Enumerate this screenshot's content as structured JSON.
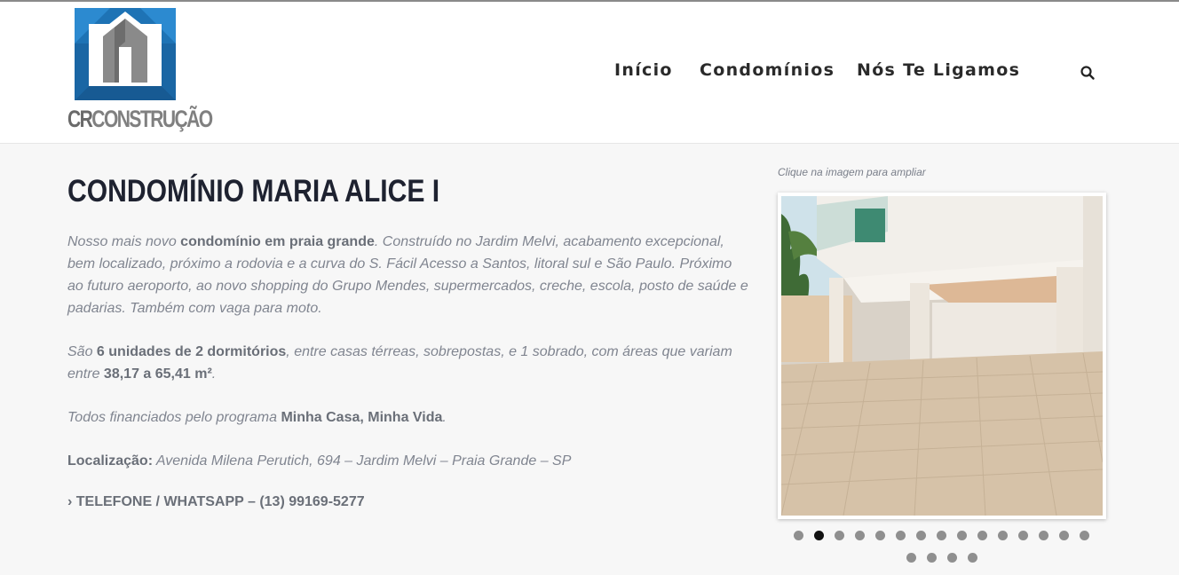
{
  "header": {
    "logo": {
      "brand_cr": "CR",
      "brand_rest": "CONSTRUÇÃO"
    },
    "nav": [
      {
        "label": "Início"
      },
      {
        "label": "Condomínios"
      },
      {
        "label": "Nós Te Ligamos"
      }
    ],
    "search_icon": "search-icon"
  },
  "page": {
    "title": "CONDOMÍNIO MARIA ALICE I",
    "p1": {
      "a": "Nosso mais novo ",
      "b": "condomínio em praia grande",
      "c": ". Construído no Jardim Melvi, acabamento excepcional, bem localizado, próximo a rodovia e a curva do S. Fácil Acesso a Santos, litoral sul e São Paulo. Próximo ao futuro aeroporto, ao novo shopping do Grupo Mendes, supermercados, creche, escola, posto de saúde e padarias. Também com vaga para moto."
    },
    "p2": {
      "a": "São ",
      "b": "6 unidades de 2 dormitórios",
      "c": ", entre casas térreas, sobrepostas, e 1 sobrado, com áreas que variam entre ",
      "d": "38,17 a 65,41 m²",
      "e": "."
    },
    "p3": {
      "a": "Todos financiados pelo programa ",
      "b": "Minha Casa, Minha Vida",
      "c": "."
    },
    "p4": {
      "a": "Localização:",
      "b": " Avenida Milena Perutich, 694 – Jardim Melvi – Praia Grande – SP"
    },
    "phone": "› TELEFONE / WHATSAPP – (13) 99169-5277"
  },
  "gallery": {
    "caption": "Clique na imagem para ampliar",
    "slide_count": 19,
    "active_index": 1,
    "photo_alt_icon": "condominium-garage-photo"
  },
  "colors": {
    "logo_blue": "#1e6fb0",
    "logo_blue_dark": "#174f86",
    "logo_gray": "#808080",
    "title": "#1e2230",
    "text": "#808590"
  }
}
